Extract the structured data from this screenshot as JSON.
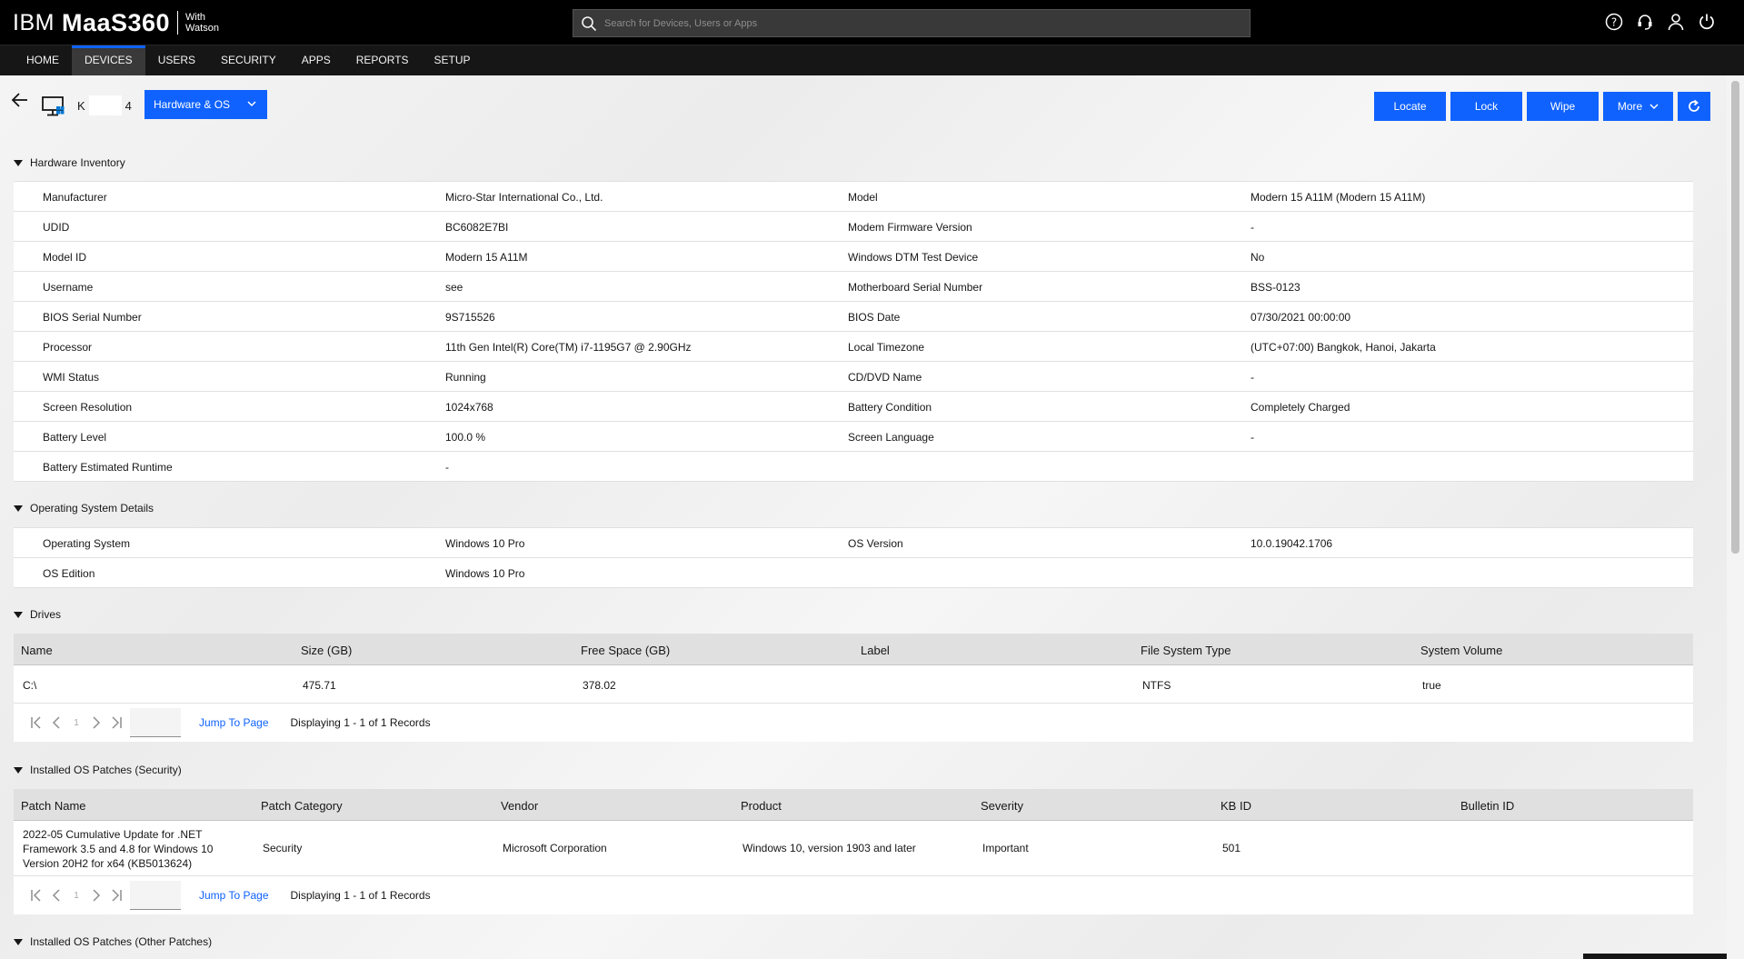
{
  "brand": {
    "ibm": "IBM",
    "product": "MaaS360",
    "with": "With",
    "watson": "Watson"
  },
  "search": {
    "placeholder": "Search for Devices, Users or Apps"
  },
  "top_icons": [
    "help-icon",
    "support-icon",
    "user-icon",
    "power-icon"
  ],
  "nav": {
    "items": [
      "HOME",
      "DEVICES",
      "USERS",
      "SECURITY",
      "APPS",
      "REPORTS",
      "SETUP"
    ],
    "active": "DEVICES"
  },
  "device": {
    "name_prefix": "K",
    "name_suffix": "4"
  },
  "view_select": {
    "value": "Hardware & OS"
  },
  "actions": {
    "locate": "Locate",
    "lock": "Lock",
    "wipe": "Wipe",
    "more": "More"
  },
  "hardware": {
    "title": "Hardware Inventory",
    "rows": [
      [
        "Manufacturer",
        "Micro-Star International Co., Ltd.",
        "Model",
        "Modern 15 A11M (Modern 15 A11M)"
      ],
      [
        "UDID",
        "BC6082E7BI",
        "Modem Firmware Version",
        "-"
      ],
      [
        "Model ID",
        "Modern 15 A11M",
        "Windows DTM Test Device",
        "No"
      ],
      [
        "Username",
        "see",
        "Motherboard Serial Number",
        "BSS-0123"
      ],
      [
        "BIOS Serial Number",
        "9S715526",
        "BIOS Date",
        "07/30/2021 00:00:00"
      ],
      [
        "Processor",
        "11th Gen Intel(R) Core(TM) i7-1195G7 @ 2.90GHz",
        "Local Timezone",
        "(UTC+07:00) Bangkok, Hanoi, Jakarta"
      ],
      [
        "WMI Status",
        "Running",
        "CD/DVD Name",
        "-"
      ],
      [
        "Screen Resolution",
        "1024x768",
        "Battery Condition",
        "Completely Charged"
      ],
      [
        "Battery Level",
        "100.0 %",
        "Screen Language",
        "-"
      ],
      [
        "Battery Estimated Runtime",
        "-",
        "",
        ""
      ]
    ]
  },
  "os": {
    "title": "Operating System Details",
    "rows": [
      [
        "Operating System",
        "Windows 10 Pro",
        "OS Version",
        "10.0.19042.1706"
      ],
      [
        "OS Edition",
        "Windows 10 Pro",
        "",
        ""
      ]
    ]
  },
  "drives": {
    "title": "Drives",
    "columns": [
      "Name",
      "Size (GB)",
      "Free Space (GB)",
      "Label",
      "File System Type",
      "System Volume"
    ],
    "rows": [
      [
        "C:\\",
        "475.71",
        "378.02",
        "",
        "NTFS",
        "true"
      ]
    ],
    "pager": {
      "page": "1",
      "jump": "Jump To Page",
      "display": "Displaying 1 - 1 of 1 Records"
    }
  },
  "patches_security": {
    "title": "Installed OS Patches (Security)",
    "columns": [
      "Patch Name",
      "Patch Category",
      "Vendor",
      "Product",
      "Severity",
      "KB ID",
      "Bulletin ID"
    ],
    "rows": [
      [
        "2022-05 Cumulative Update for .NET Framework 3.5 and 4.8 for Windows 10 Version 20H2 for x64 (KB5013624)",
        "Security",
        "Microsoft Corporation",
        "Windows 10, version 1903 and later",
        "Important",
        "501",
        ""
      ]
    ],
    "pager": {
      "page": "1",
      "jump": "Jump To Page",
      "display": "Displaying 1 - 1 of 1 Records"
    }
  },
  "patches_other": {
    "title": "Installed OS Patches (Other Patches)"
  },
  "colors": {
    "accent": "#0f62fe",
    "topbar": "#000000",
    "nav": "#161616"
  }
}
